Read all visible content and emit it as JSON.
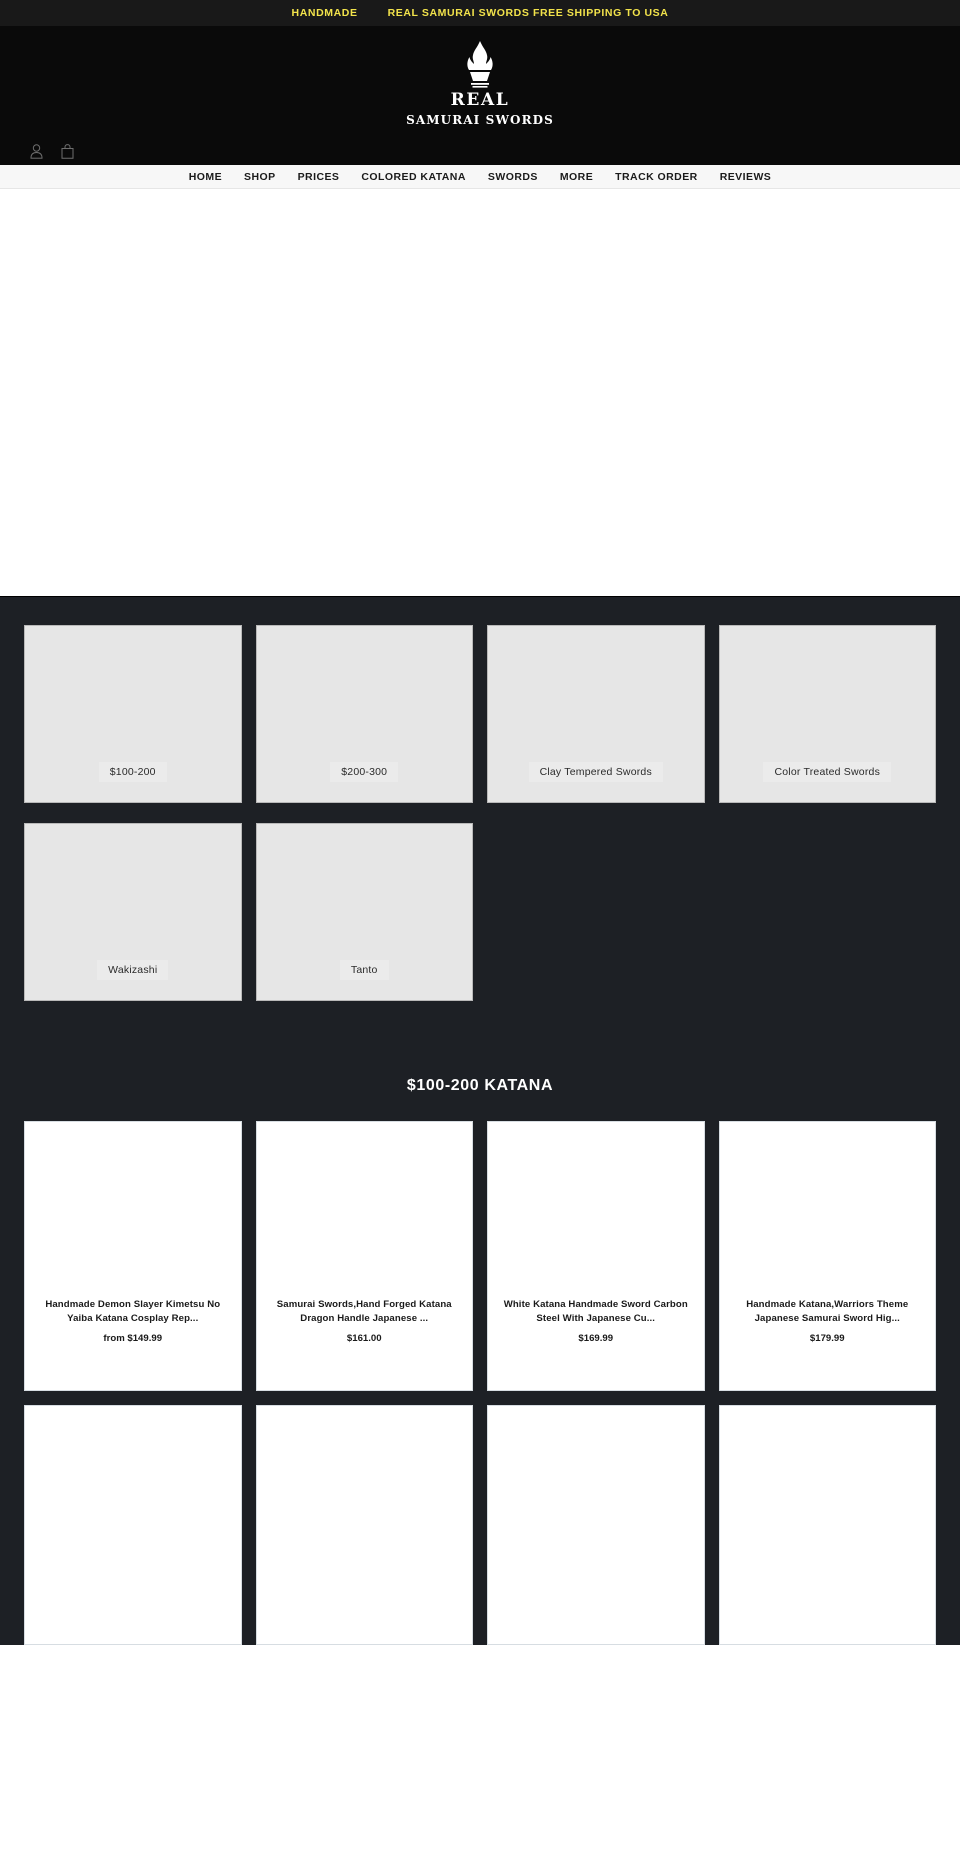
{
  "announcement": {
    "items": [
      "HANDMADE",
      "REAL SAMURAI SWORDS FREE SHIPPING TO USA"
    ],
    "color": "#f2e34b",
    "background": "#191919"
  },
  "header": {
    "logo": {
      "icon": "flame-torch-icon",
      "line1": "REAL",
      "line2": "SAMURAI SWORDS"
    },
    "icons": [
      {
        "name": "account-icon",
        "label": "Account"
      },
      {
        "name": "cart-icon",
        "label": "Cart"
      }
    ],
    "background": "#0a0a0a"
  },
  "nav": {
    "items": [
      {
        "label": "HOME"
      },
      {
        "label": "SHOP"
      },
      {
        "label": "PRICES"
      },
      {
        "label": "COLORED KATANA"
      },
      {
        "label": "SWORDS"
      },
      {
        "label": "MORE"
      },
      {
        "label": "TRACK ORDER"
      },
      {
        "label": "REVIEWS"
      }
    ],
    "background": "#f7f7f7"
  },
  "collections": {
    "row1": [
      {
        "label": "$100-200"
      },
      {
        "label": "$200-300"
      },
      {
        "label": "Clay Tempered Swords"
      },
      {
        "label": "Color Treated Swords"
      }
    ],
    "row2": [
      {
        "label": "Wakizashi"
      },
      {
        "label": "Tanto"
      }
    ]
  },
  "featured": {
    "heading": "$100-200 KATANA",
    "products_row1": [
      {
        "title": "Handmade Demon Slayer Kimetsu No Yaiba Katana Cosplay Rep...",
        "price": "from $149.99"
      },
      {
        "title": "Samurai Swords,Hand Forged Katana Dragon Handle Japanese ...",
        "price": "$161.00"
      },
      {
        "title": "White Katana Handmade Sword Carbon Steel With Japanese Cu...",
        "price": "$169.99"
      },
      {
        "title": "Handmade Katana,Warriors Theme Japanese Samurai Sword Hig...",
        "price": "$179.99"
      }
    ],
    "products_row2": [
      {
        "title": "",
        "price": ""
      },
      {
        "title": "",
        "price": ""
      },
      {
        "title": "",
        "price": ""
      },
      {
        "title": "",
        "price": ""
      }
    ]
  },
  "theme": {
    "dark_background": "#1d2025",
    "tile_background": "#e6e6e6",
    "accent_yellow": "#f2e34b"
  }
}
